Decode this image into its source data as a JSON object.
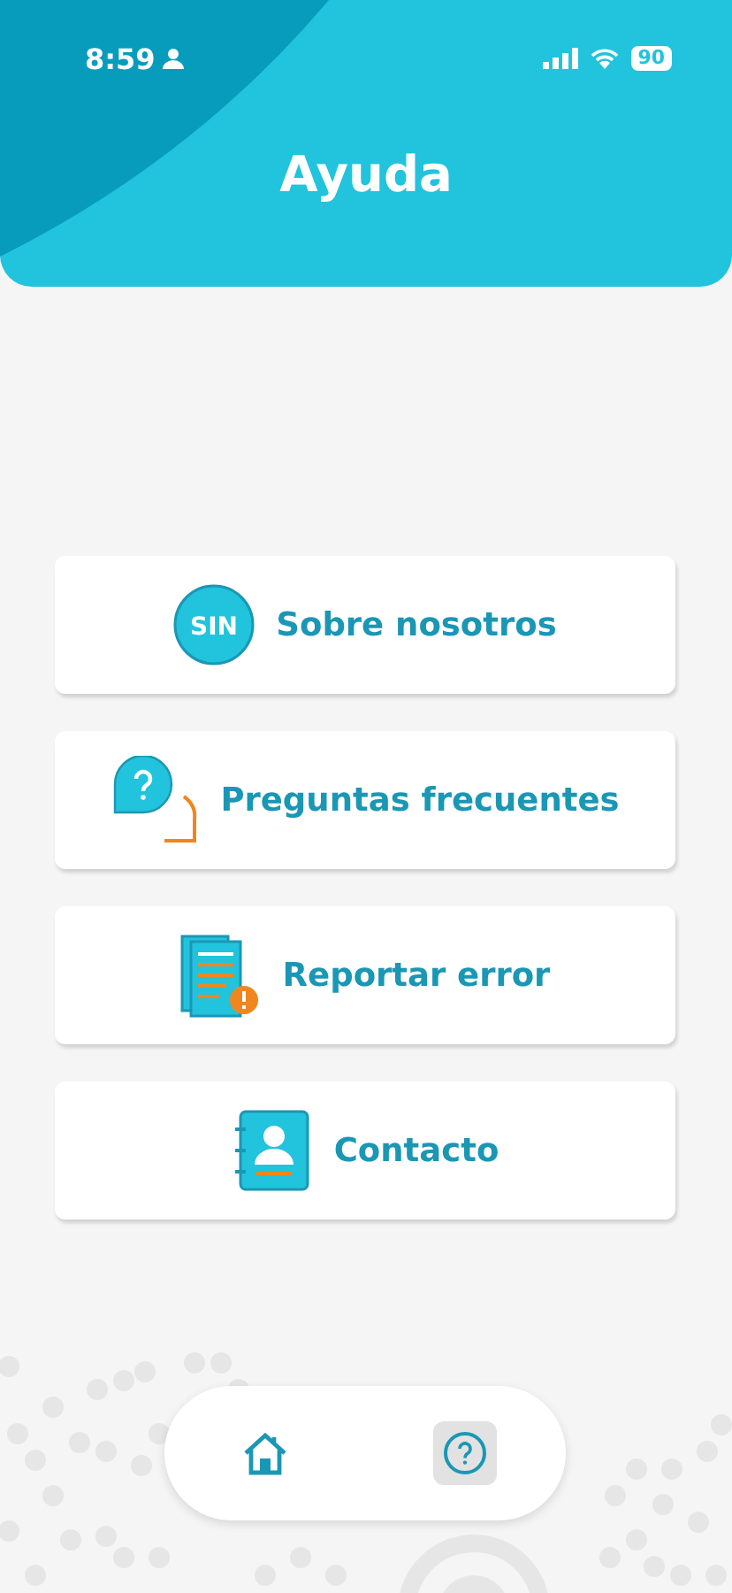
{
  "status_bar": {
    "time": "8:59",
    "battery": "90"
  },
  "header": {
    "title": "Ayuda"
  },
  "menu": [
    {
      "kind": "logo",
      "logo_text": "SIN",
      "label": "Sobre nosotros"
    },
    {
      "kind": "faq",
      "label": "Preguntas frecuentes"
    },
    {
      "kind": "report",
      "label": "Reportar error"
    },
    {
      "kind": "contact",
      "label": "Contacto"
    }
  ],
  "bottom_nav": [
    {
      "kind": "home",
      "selected": false
    },
    {
      "kind": "help",
      "selected": true
    }
  ]
}
